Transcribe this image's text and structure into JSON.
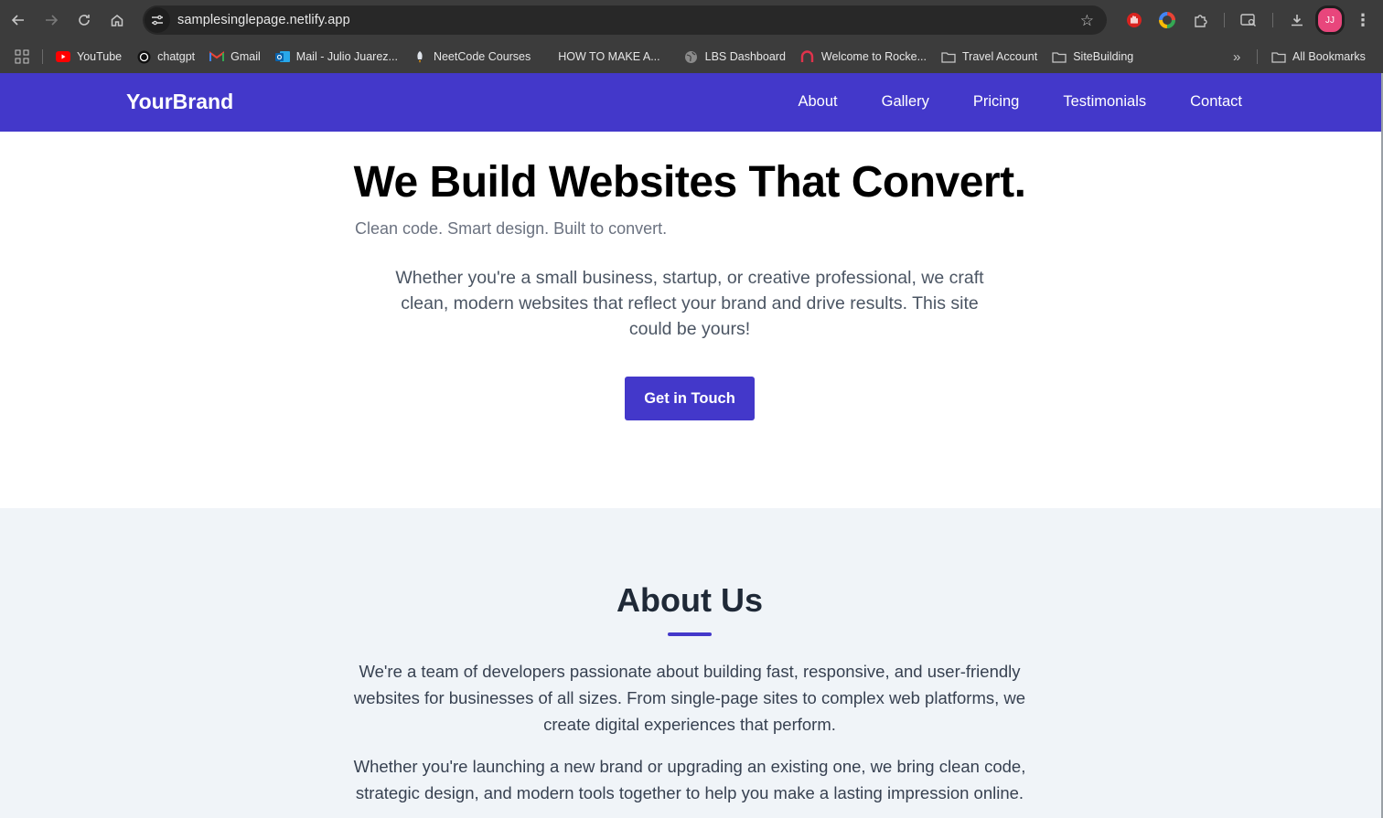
{
  "browser": {
    "url": "samplesinglepage.netlify.app",
    "bookmarks": [
      {
        "label": "YouTube",
        "icon": "youtube-icon"
      },
      {
        "label": "chatgpt",
        "icon": "chatgpt-icon"
      },
      {
        "label": "Gmail",
        "icon": "gmail-icon"
      },
      {
        "label": "Mail - Julio Juarez...",
        "icon": "outlook-icon"
      },
      {
        "label": "NeetCode Courses",
        "icon": "rocket-icon"
      },
      {
        "label": "HOW TO MAKE A...",
        "icon": "blank-icon"
      },
      {
        "label": "LBS Dashboard",
        "icon": "globe-icon"
      },
      {
        "label": "Welcome to Rocke...",
        "icon": "rocket-chat-icon"
      },
      {
        "label": "Travel Account",
        "icon": "folder-icon"
      },
      {
        "label": "SiteBuilding",
        "icon": "folder-icon"
      }
    ],
    "all_bookmarks_label": "All Bookmarks",
    "profile_initials": "JJ"
  },
  "site": {
    "brand": "YourBrand",
    "nav": [
      "About",
      "Gallery",
      "Pricing",
      "Testimonials",
      "Contact"
    ],
    "hero": {
      "title": "We Build Websites That Convert.",
      "tagline": "Clean code. Smart design. Built to convert.",
      "body": "Whether you're a small business, startup, or creative professional, we craft clean, modern websites that reflect your brand and drive results. This site could be yours!",
      "cta": "Get in Touch"
    },
    "about": {
      "title": "About Us",
      "p1": "We're a team of developers passionate about building fast, responsive, and user-friendly websites for businesses of all sizes. From single-page sites to complex web platforms, we create digital experiences that perform.",
      "p2": "Whether you're launching a new brand or upgrading an existing one, we bring clean code, strategic design, and modern tools together to help you make a lasting impression online."
    }
  },
  "colors": {
    "brand_primary": "#4338ca",
    "about_bg": "#f0f4f8",
    "chrome_bg": "#3c3c3c"
  }
}
